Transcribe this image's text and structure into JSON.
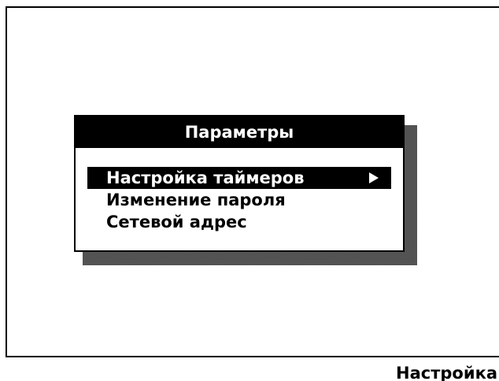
{
  "dialog": {
    "title": "Параметры",
    "items": [
      {
        "label": "Настройка таймеров",
        "selected": true,
        "has_submenu": true,
        "icon": "submenu-arrow-icon"
      },
      {
        "label": "Изменение пароля",
        "selected": false,
        "has_submenu": false
      },
      {
        "label": "Сетевой адрес",
        "selected": false,
        "has_submenu": false
      }
    ]
  },
  "status_bar": {
    "mode_label": "Настройка"
  },
  "colors": {
    "background": "#ffffff",
    "foreground": "#000000",
    "highlight": "#000000",
    "highlight_text": "#ffffff"
  }
}
